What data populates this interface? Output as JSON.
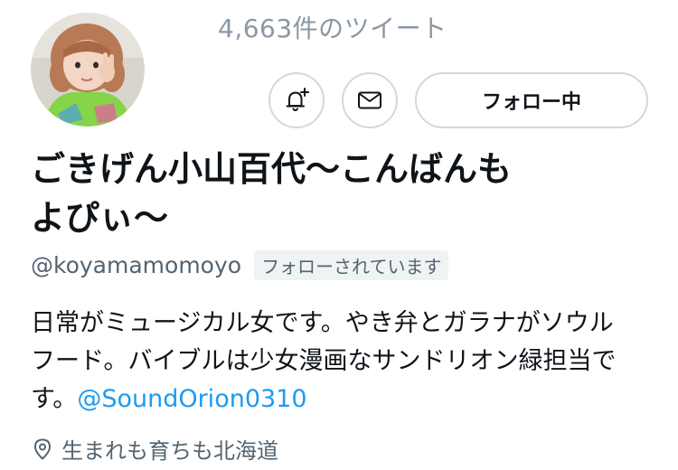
{
  "profile": {
    "tweet_count": "4,663件のツイート",
    "display_name_line1": "ごきげん小山百代〜こんばんも",
    "display_name_line2": "よぴぃ〜",
    "handle": "@koyamamomoyo",
    "follows_you_badge": "フォローされています",
    "bio_line1": "日常がミュージカル女です。やき弁とガラナがソウル",
    "bio_line2": "フード。バイブルは少女漫画なサンドリオン緑担当で",
    "bio_line3_text": "す。",
    "bio_mention": "@SoundOrion0310",
    "location": "生まれも育ちも北海道"
  },
  "actions": {
    "notify_icon": "bell-plus-icon",
    "message_icon": "envelope-icon",
    "follow_button_label": "フォロー中"
  },
  "colors": {
    "accent": "#1d9bf0",
    "secondary_text": "#536471",
    "border": "#cfd9de",
    "badge_bg": "#eff3f4"
  }
}
